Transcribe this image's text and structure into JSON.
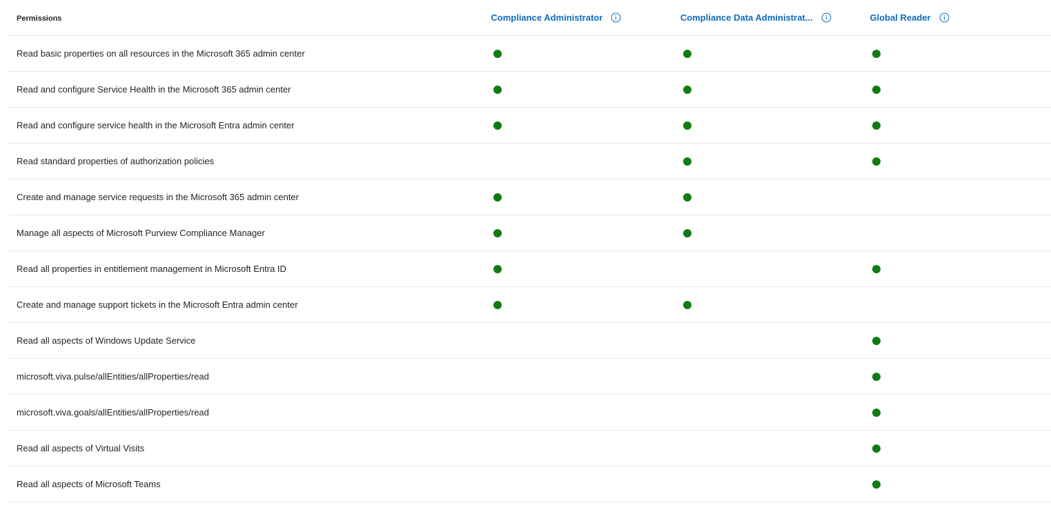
{
  "header": {
    "permissions_label": "Permissions",
    "roles": [
      {
        "label": "Compliance Administrator"
      },
      {
        "label": "Compliance Data Administrat..."
      },
      {
        "label": "Global Reader"
      }
    ]
  },
  "status_color": "#107c10",
  "rows": [
    {
      "permission": "Read basic properties on all resources in the Microsoft 365 admin center",
      "granted": [
        true,
        true,
        true
      ]
    },
    {
      "permission": "Read and configure Service Health in the Microsoft 365 admin center",
      "granted": [
        true,
        true,
        true
      ]
    },
    {
      "permission": "Read and configure service health in the Microsoft Entra admin center",
      "granted": [
        true,
        true,
        true
      ]
    },
    {
      "permission": "Read standard properties of authorization policies",
      "granted": [
        false,
        true,
        true
      ]
    },
    {
      "permission": "Create and manage service requests in the Microsoft 365 admin center",
      "granted": [
        true,
        true,
        false
      ]
    },
    {
      "permission": "Manage all aspects of Microsoft Purview Compliance Manager",
      "granted": [
        true,
        true,
        false
      ]
    },
    {
      "permission": "Read all properties in entitlement management in Microsoft Entra ID",
      "granted": [
        true,
        false,
        true
      ]
    },
    {
      "permission": "Create and manage support tickets in the Microsoft Entra admin center",
      "granted": [
        true,
        true,
        false
      ]
    },
    {
      "permission": "Read all aspects of Windows Update Service",
      "granted": [
        false,
        false,
        true
      ]
    },
    {
      "permission": "microsoft.viva.pulse/allEntities/allProperties/read",
      "granted": [
        false,
        false,
        true
      ]
    },
    {
      "permission": "microsoft.viva.goals/allEntities/allProperties/read",
      "granted": [
        false,
        false,
        true
      ]
    },
    {
      "permission": "Read all aspects of Virtual Visits",
      "granted": [
        false,
        false,
        true
      ]
    },
    {
      "permission": "Read all aspects of Microsoft Teams",
      "granted": [
        false,
        false,
        true
      ]
    }
  ]
}
